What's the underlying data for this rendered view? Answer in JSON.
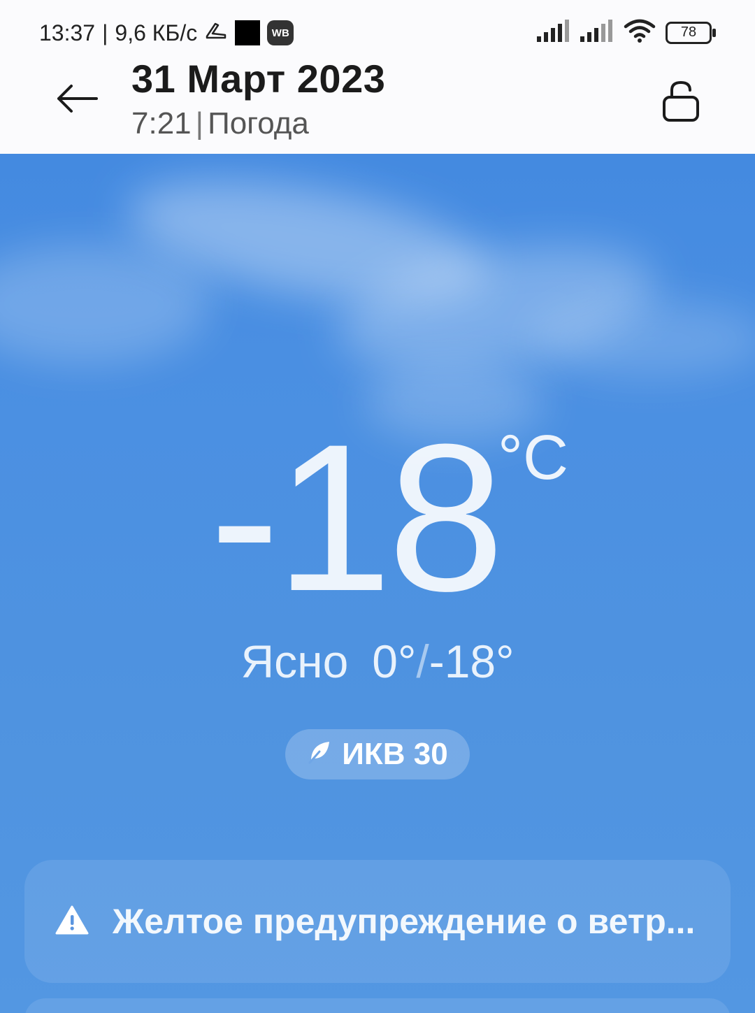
{
  "status_bar": {
    "time": "13:37",
    "separator": "|",
    "network_speed": "9,6 КБ/с",
    "wb_label": "WB",
    "battery": "78"
  },
  "header": {
    "title": "31 Март 2023",
    "time": "7:21",
    "separator": "|",
    "app_name": "Погода"
  },
  "weather": {
    "temperature": "-18",
    "unit": "°C",
    "condition": "Ясно",
    "high": "0°",
    "slash": "/",
    "low": "-18°",
    "aqi_label": "ИКВ 30"
  },
  "alert": {
    "text": "Желтое предупреждение о ветр..."
  },
  "icons": {
    "back": "arrow-left-icon",
    "lock": "unlock-icon",
    "aqi": "leaf-icon",
    "alert": "warning-icon"
  },
  "colors": {
    "sky_top": "#3f86df",
    "sky_bottom": "#5397e2",
    "header_bg": "#fbfbfd"
  }
}
